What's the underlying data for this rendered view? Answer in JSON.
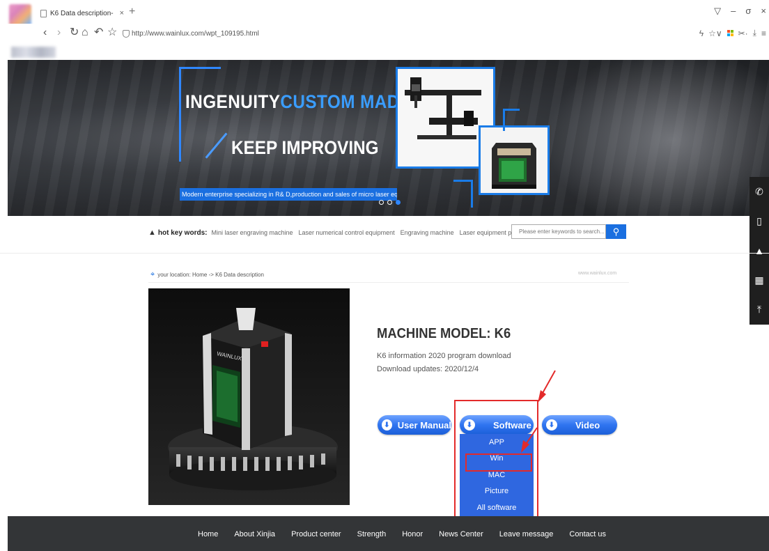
{
  "browser": {
    "tab_title": "K6 Data description-",
    "tab_close": "×",
    "new_tab": "+",
    "url": "http://www.wainlux.com/wpt_109195.html",
    "window_controls": [
      "▽",
      "–",
      "σ",
      "×"
    ],
    "nav_icons": [
      "back-icon",
      "forward-icon",
      "refresh-icon",
      "home-icon",
      "undo-icon",
      "star-icon"
    ]
  },
  "banner": {
    "headline_white": "INGENUITY",
    "headline_blue": "CUSTOM MADE",
    "headline2": "KEEP IMPROVING",
    "tagline": "Modern enterprise specializing in R& D,production and sales of micro laser equipment",
    "colors": {
      "accent": "#2f87ff",
      "tagline_bg": "#1a6fe0"
    }
  },
  "hotkeys": {
    "label": "hot key words:",
    "keywords": [
      "Mini laser engraving machine",
      "Laser numerical control equipment",
      "Engraving machine",
      "Laser equipment parts"
    ],
    "search_placeholder": "Please enter keywords to search..."
  },
  "location": {
    "text": "your location: Home -> K6 Data description",
    "domain": "www.wainlux.com"
  },
  "product": {
    "title": "MACHINE MODEL:  K6",
    "info_line1": "K6 information 2020 program download",
    "info_line2": "Download updates:  2020/12/4"
  },
  "buttons": {
    "user_manual": "User Manual",
    "software": "Software",
    "video": "Video"
  },
  "software_menu": [
    "APP",
    "Win",
    "MAC",
    "Picture",
    "All software"
  ],
  "footer": {
    "nav": [
      "Home",
      "About Xinjia",
      "Product center",
      "Strength",
      "Honor",
      "News Center",
      "Leave message",
      "Contact us"
    ]
  }
}
